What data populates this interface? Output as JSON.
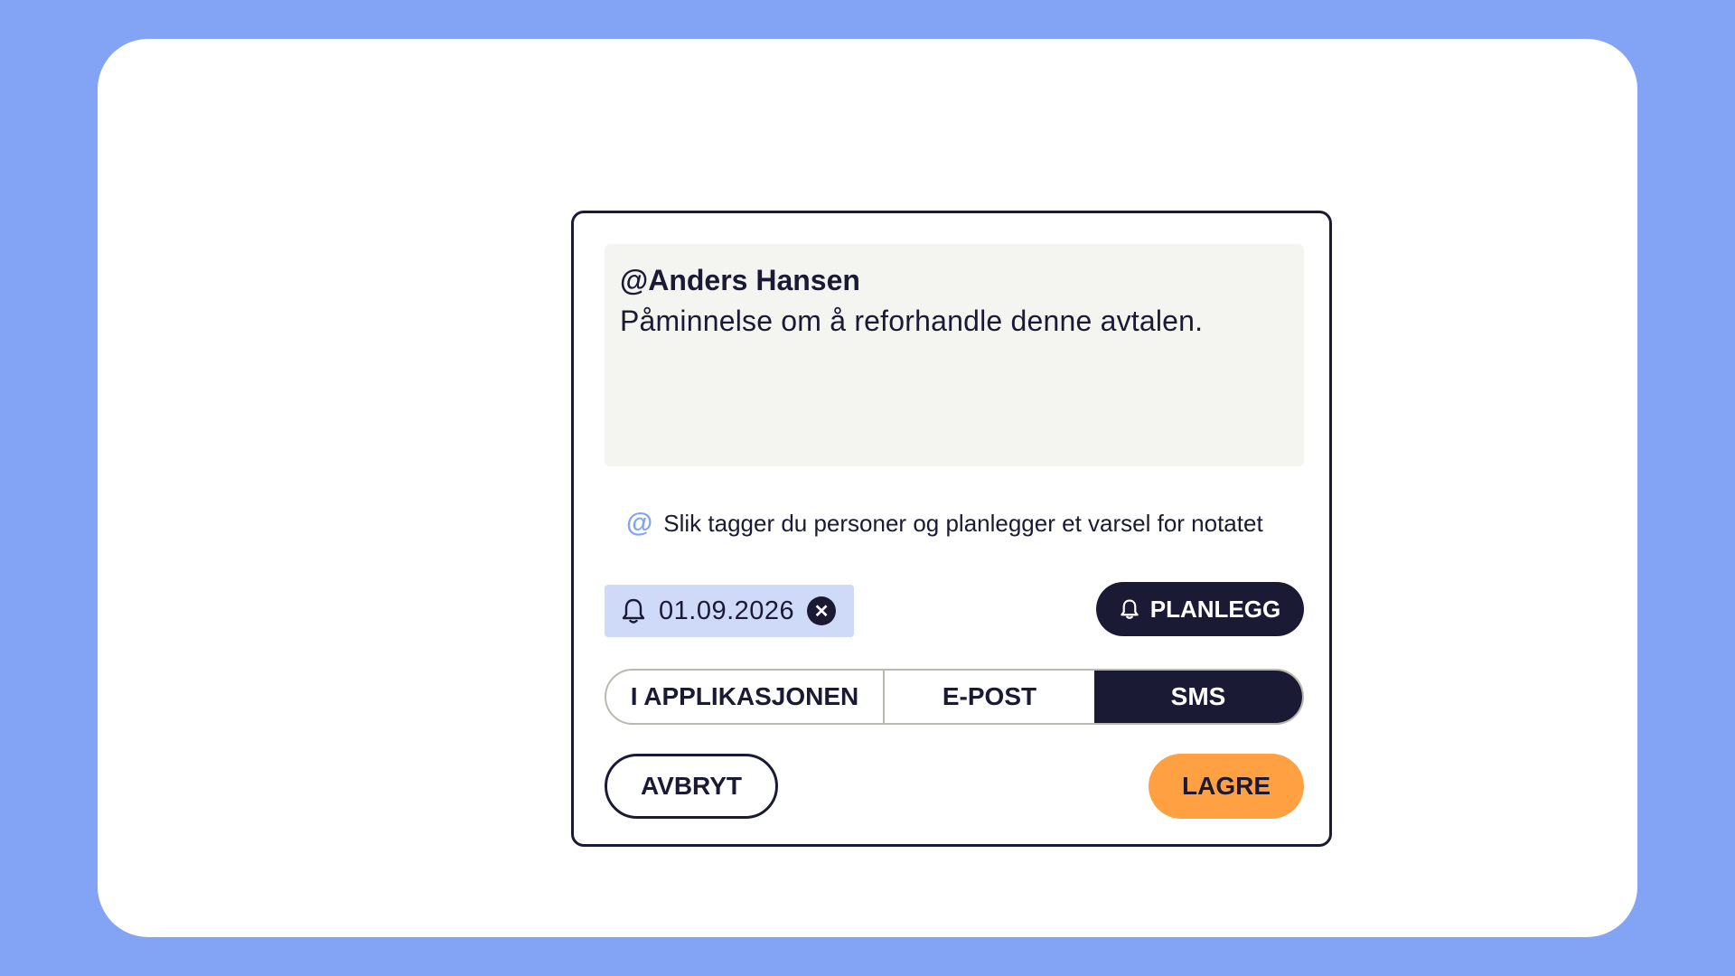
{
  "note": {
    "mention": "@Anders Hansen",
    "text": "Påminnelse om å reforhandle denne avtalen."
  },
  "hint": {
    "icon": "at-icon",
    "text": "Slik tagger du personer og planlegger et varsel for notatet"
  },
  "reminder": {
    "icon": "bell-icon",
    "date": "01.09.2026",
    "clear_icon": "close-circle-icon"
  },
  "schedule_button": {
    "icon": "bell-icon",
    "label": "PLANLEGG"
  },
  "channels": {
    "options": [
      "I APPLIKASJONEN",
      "E-POST",
      "SMS"
    ],
    "selected": "SMS"
  },
  "actions": {
    "cancel_label": "AVBRYT",
    "save_label": "LAGRE"
  },
  "colors": {
    "background": "#83a4f5",
    "navy": "#1b1a35",
    "chip": "#cfdaf9",
    "note_bg": "#f4f4f0",
    "save": "#ffa043"
  }
}
